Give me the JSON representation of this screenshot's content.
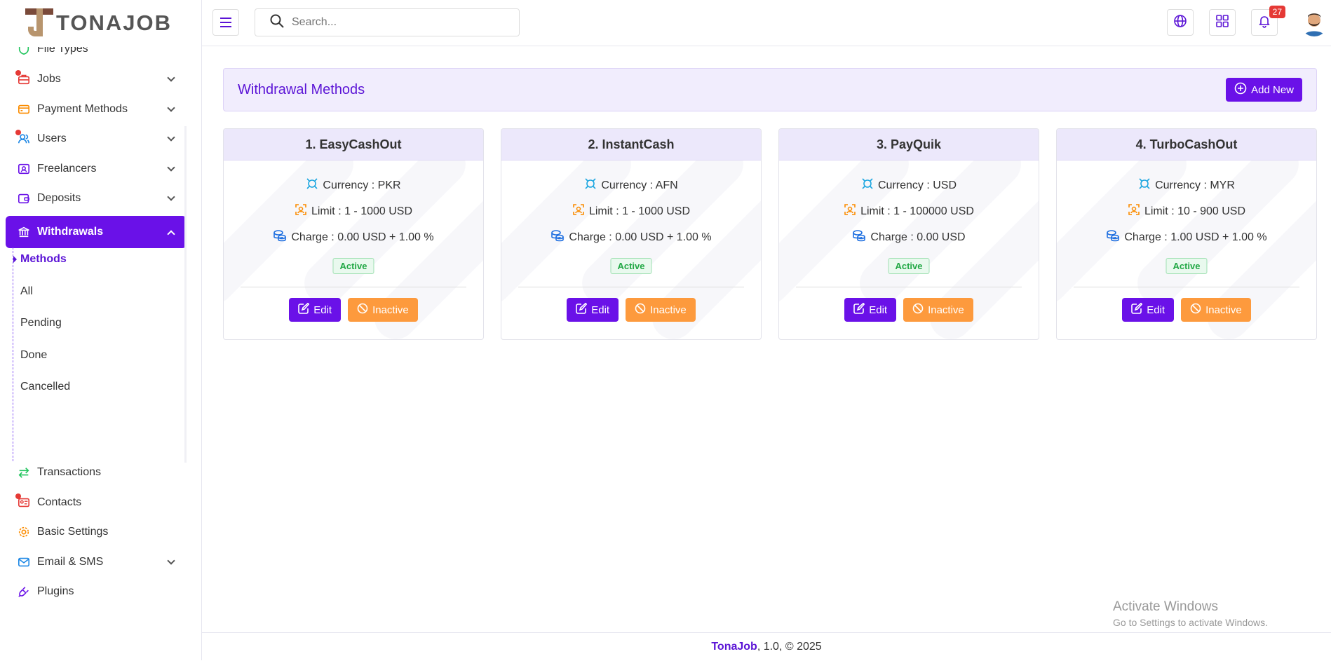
{
  "brand": {
    "logo_text": "TONAJOB"
  },
  "sidebar": {
    "items": [
      {
        "label": "File Types"
      },
      {
        "label": "Jobs"
      },
      {
        "label": "Payment Methods"
      },
      {
        "label": "Users"
      },
      {
        "label": "Freelancers"
      },
      {
        "label": "Deposits"
      },
      {
        "label": "Withdrawals"
      },
      {
        "label": "Transactions"
      },
      {
        "label": "Contacts"
      },
      {
        "label": "Basic Settings"
      },
      {
        "label": "Email & SMS"
      },
      {
        "label": "Plugins"
      }
    ],
    "submenu": [
      {
        "label": "Methods"
      },
      {
        "label": "All"
      },
      {
        "label": "Pending"
      },
      {
        "label": "Done"
      },
      {
        "label": "Cancelled"
      }
    ]
  },
  "header": {
    "search_placeholder": "Search...",
    "notification_count": "27"
  },
  "page": {
    "title": "Withdrawal Methods",
    "add_label": "Add New"
  },
  "methods": [
    {
      "name": "1. EasyCashOut",
      "currency": "Currency : PKR",
      "limit": "Limit : 1 - 1000 USD",
      "charge": "Charge : 0.00 USD + 1.00 %",
      "status": "Active",
      "edit": "Edit",
      "toggle": "Inactive"
    },
    {
      "name": "2. InstantCash",
      "currency": "Currency : AFN",
      "limit": "Limit : 1 - 1000 USD",
      "charge": "Charge : 0.00 USD + 1.00 %",
      "status": "Active",
      "edit": "Edit",
      "toggle": "Inactive"
    },
    {
      "name": "3. PayQuik",
      "currency": "Currency : USD",
      "limit": "Limit : 1 - 100000 USD",
      "charge": "Charge : 0.00 USD",
      "status": "Active",
      "edit": "Edit",
      "toggle": "Inactive"
    },
    {
      "name": "4. TurboCashOut",
      "currency": "Currency : MYR",
      "limit": "Limit : 10 - 900 USD",
      "charge": "Charge : 1.00 USD + 1.00 %",
      "status": "Active",
      "edit": "Edit",
      "toggle": "Inactive"
    }
  ],
  "footer": {
    "brand": "TonaJob",
    "rest": ", 1.0, © 2025"
  },
  "watermark": {
    "title": "Activate Windows",
    "subtitle": "Go to Settings to activate Windows."
  },
  "colors": {
    "primary": "#6a11e8",
    "accent_orange": "#fd9a3d",
    "success": "#22a845"
  }
}
